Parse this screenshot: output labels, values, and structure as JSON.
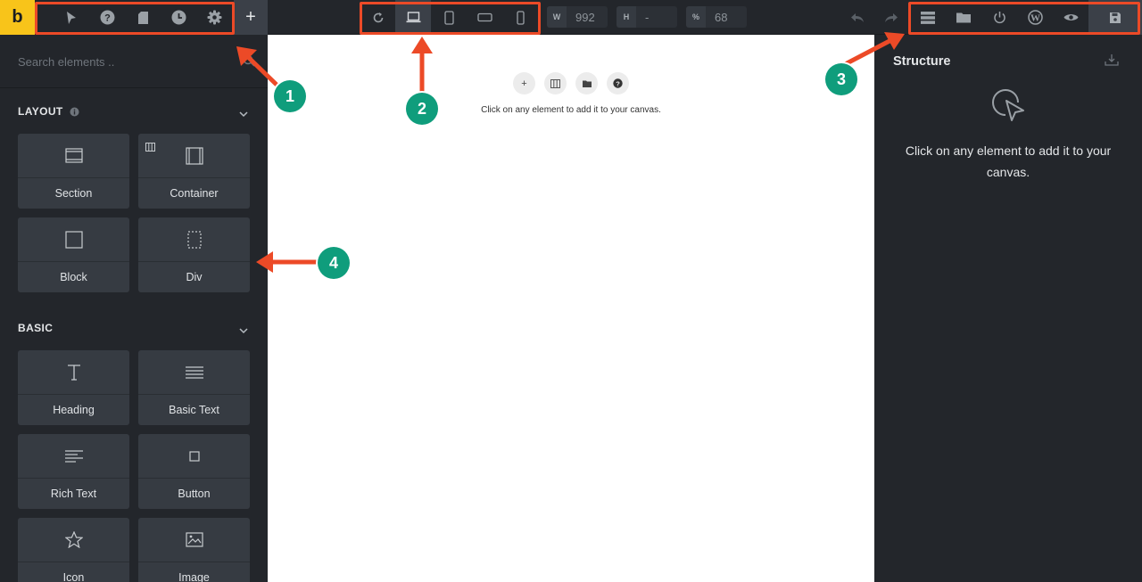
{
  "app": {
    "logo_letter": "b"
  },
  "toolbar_left": {
    "icons": [
      "select-icon",
      "help-icon",
      "pages-icon",
      "history-icon",
      "settings-icon"
    ],
    "add_label": "+"
  },
  "toolbar_center": {
    "devices": [
      "refresh-icon",
      "laptop-icon",
      "tablet-portrait-icon",
      "tablet-landscape-icon",
      "phone-icon"
    ],
    "active_device": "laptop-icon",
    "width_label": "W",
    "width_value": "992",
    "height_label": "H",
    "height_value": "-",
    "zoom_label": "%",
    "zoom_value": "68"
  },
  "toolbar_right": {
    "icons": [
      "undo-icon",
      "redo-icon",
      "structure-icon",
      "folder-icon",
      "power-icon",
      "wordpress-icon",
      "preview-icon",
      "save-icon"
    ]
  },
  "sidebar": {
    "search_placeholder": "Search elements ..",
    "categories": [
      {
        "title": "LAYOUT",
        "items": [
          {
            "label": "Section",
            "icon": "section-icon"
          },
          {
            "label": "Container",
            "icon": "container-icon"
          },
          {
            "label": "Block",
            "icon": "block-icon"
          },
          {
            "label": "Div",
            "icon": "div-icon"
          }
        ]
      },
      {
        "title": "BASIC",
        "items": [
          {
            "label": "Heading",
            "icon": "heading-icon"
          },
          {
            "label": "Basic Text",
            "icon": "basic-text-icon"
          },
          {
            "label": "Rich Text",
            "icon": "rich-text-icon"
          },
          {
            "label": "Button",
            "icon": "button-icon"
          },
          {
            "label": "Icon",
            "icon": "star-icon"
          },
          {
            "label": "Image",
            "icon": "image-icon"
          }
        ]
      }
    ]
  },
  "canvas": {
    "actions": [
      "+",
      "columns-icon",
      "folder-icon",
      "?"
    ],
    "hint": "Click on any element to add it to your canvas."
  },
  "structure_panel": {
    "title": "Structure",
    "hint": "Click on any element to add it to your canvas."
  },
  "annotations": [
    "1",
    "2",
    "3",
    "4"
  ],
  "colors": {
    "brand_yellow": "#f8c41a",
    "highlight_red": "#ec4a27",
    "badge_teal": "#0f9d7c",
    "panel_dark": "#23262b",
    "tile_bg": "#363b42"
  }
}
